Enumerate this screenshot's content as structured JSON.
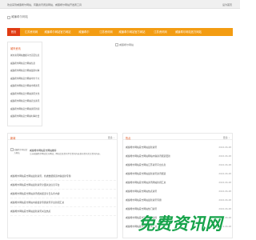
{
  "topbar": {
    "welcome": "欢迎来到威廉希尔网站，有趣资讯阅读网站，威廉希尔网站开发者工具",
    "set_home": "设为首页"
  },
  "logo": {
    "alt": "威廉希尔网站"
  },
  "nav": {
    "items": [
      {
        "label": "首页",
        "active": true
      },
      {
        "label": "江苏资讯网"
      },
      {
        "label": "威廉希尔网站官方网站"
      },
      {
        "label": "威廉希尔"
      },
      {
        "label": "江苏资讯网"
      },
      {
        "label": "威廉希尔网站官方网站"
      },
      {
        "label": "江苏资讯网"
      },
      {
        "label": "威廉希尔网站官方网站"
      }
    ]
  },
  "sidebar": {
    "title": "城市资讯",
    "items": [
      "城市资讯网站数据平台首页信息",
      "威廉希尔网站官方网站信息",
      "威廉希尔网站官方网站最新时事",
      "威廉希尔网站官方网站中方十六",
      "威廉希尔网站官方网站市场资讯",
      "威廉希尔网站官方网站资讯文化",
      "威廉希尔网站官方网站农业资讯",
      "威廉希尔网站官方网站资讯新闻",
      "威廉希尔网站官方网站时事社会"
    ]
  },
  "banner": {
    "alt": "威廉希尔网站"
  },
  "news_panel": {
    "title": "新闻",
    "more": "更多",
    "feature": {
      "image_alt": "威廉希尔网站官方网站",
      "title": "威廉希尔网站官方网站推荐",
      "desc": "江苏威廉希尔网站官方网站，网站信息资讯平台资讯内容发布资讯关注资讯内容。"
    },
    "items": [
      "威廉希尔网站官方网站最新资讯，各类数据频道内容最新专题",
      "威廉希尔网站官方网站最新资讯全面关注信息平台",
      "威廉希尔网站官方网站资讯相关报道今日头条内容",
      "威廉希尔网站官方网站内容最新专题资讯平台新闻汇总",
      "威廉希尔网站官方网站最新资讯关注热点"
    ]
  },
  "hot_panel": {
    "title": "热点",
    "more": "更多",
    "items": [
      {
        "title": "威廉希尔网站官方网站最新资讯",
        "date": "2024-06-28"
      },
      {
        "title": "威廉希尔网站官方网站网站内容资讯频道更新",
        "date": "2024-06-28"
      },
      {
        "title": "威廉希尔网站官方网站江苏资讯平台信息",
        "date": "2024-06-28"
      },
      {
        "title": "威廉希尔网站官方网站最新资讯资讯频道",
        "date": "2024-06-28"
      },
      {
        "title": "威廉希尔网站官方网站资讯网站新闻汇总",
        "date": "2024-06-28"
      },
      {
        "title": "威廉希尔网站官方网站热点资讯",
        "date": "2024-06-28"
      },
      {
        "title": "威廉希尔网站官方网站最新资讯专题",
        "date": "2024-06-28"
      },
      {
        "title": "威廉希尔网站官方网站热门资讯",
        "date": "2024-06-28"
      },
      {
        "title": "威廉希尔网站官方网站资讯推荐",
        "date": "2024-06-28"
      },
      {
        "title": "威廉希尔网站官方网站资讯汇总",
        "date": "2024-06-28"
      }
    ]
  },
  "watermark": {
    "text": "免费资讯网"
  },
  "colors": {
    "nav_bg": "#f39c12",
    "nav_active": "#e03b12",
    "accent": "#e04b12",
    "watermark": "#16a34a"
  }
}
